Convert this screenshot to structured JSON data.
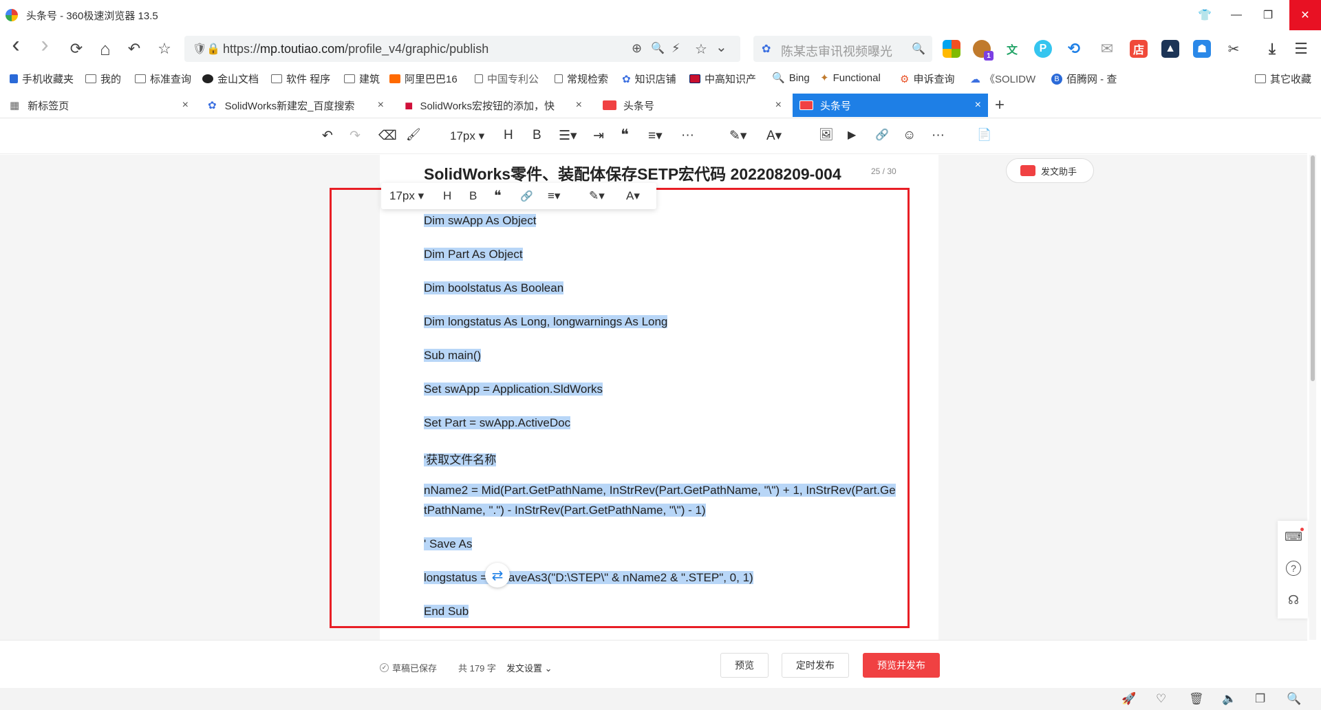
{
  "window": {
    "title": "头条号 - 360极速浏览器 13.5",
    "controls": {
      "shirt": "👕",
      "minimize": "—",
      "restore": "❐",
      "close": "✕"
    }
  },
  "nav": {
    "back": "‹",
    "forward": "›",
    "reload": "⟳",
    "home": "⌂",
    "undo": "↶",
    "star": "☆",
    "url_prefix": "https://",
    "url_host": "mp.toutiao.com",
    "url_path": "/profile_v4/graphic/publish",
    "url_icons": {
      "zoom_in": "⊕",
      "zoom_out": "🔍",
      "lightning": "⚡",
      "fav": "☆",
      "dropdown": "⌄"
    },
    "search_text": "陈某志审讯视频曝光",
    "search_icon": "🔍"
  },
  "extensions": {
    "profile_badge": "1",
    "translate": "文",
    "p_label": "P",
    "mail": "✉",
    "scissors": "✂",
    "download": "⤓",
    "menu": "☰"
  },
  "bookmarks": [
    "手机收藏夹",
    "我的",
    "标准查询",
    "金山文档",
    "软件 程序",
    "建筑",
    "阿里巴巴16",
    "中国专利公",
    "常规检索",
    "知识店铺",
    "中高知识产",
    "Bing",
    "Functional",
    "申诉查询",
    "《SOLIDW",
    "佰腾网 - 查"
  ],
  "bookmarks_other": "其它收藏",
  "tabs": [
    {
      "label": "新标签页"
    },
    {
      "label": "SolidWorks新建宏_百度搜索"
    },
    {
      "label": "SolidWorks宏按钮的添加，快"
    },
    {
      "label": "头条号"
    },
    {
      "label": "头条号"
    }
  ],
  "tab_close": "×",
  "tab_new": "+",
  "editor_toolbar": {
    "undo": "↶",
    "redo": "↷",
    "eraser": "⌫",
    "format_painter": "🖌",
    "font_size": "17px ▾",
    "heading": "H",
    "bold": "B",
    "list": "☰▾",
    "indent": "⇥",
    "quote": "❝",
    "align": "≡▾",
    "more": "···",
    "highlight": "✎▾",
    "font_color": "A▾",
    "image": "🖼",
    "video": "▶",
    "link": "🔗",
    "emoji": "☺",
    "more2": "···",
    "page": "📄"
  },
  "document": {
    "title": "SolidWorks零件、装配体保存SETP宏代码 202208209-004",
    "counter": "25 / 30",
    "assistant": "发文助手",
    "lines": [
      "Dim swApp As Object",
      "Dim Part As Object",
      "Dim boolstatus As Boolean",
      "Dim longstatus As Long, longwarnings As Long",
      "Sub main()",
      "Set swApp = Application.SldWorks",
      "Set Part = swApp.ActiveDoc",
      "'获取文件名称",
      "nName2 = Mid(Part.GetPathName, InStrRev(Part.GetPathName, \"\\\") + 1, InStrRev(Part.Ge",
      "tPathName, \".\") - InStrRev(Part.GetPathName, \"\\\") - 1)",
      "' Save As",
      "longstatus = ",
      ".SaveAs3(\"D:\\STEP\\\" & nName2 & \".STEP\", 0, 1)",
      "End Sub"
    ]
  },
  "float_toolbar": {
    "font_size": "17px ▾",
    "heading": "H",
    "bold": "B",
    "quote": "❝",
    "link": "🔗",
    "align": "≡▾",
    "highlight": "✎▾",
    "font_color": "A▾"
  },
  "convert_icon": "⇄",
  "side_panel": {
    "keyboard": "⌨",
    "help": "?",
    "support": "☊"
  },
  "action_bar": {
    "saved": "草稿已保存",
    "word_count": "共 179 字",
    "settings": "发文设置 ⌄",
    "preview": "预览",
    "schedule": "定时发布",
    "publish": "预览并发布"
  },
  "status_bar": {
    "rocket": "🚀",
    "heart": "♡",
    "trash": "🗑",
    "speaker": "🔈",
    "window": "❐",
    "search": "🔍"
  },
  "colors": {
    "accent": "#1e7fe6",
    "publish": "#f04142",
    "selection": "#b8d6f7",
    "annotation_box": "#e81e25"
  }
}
